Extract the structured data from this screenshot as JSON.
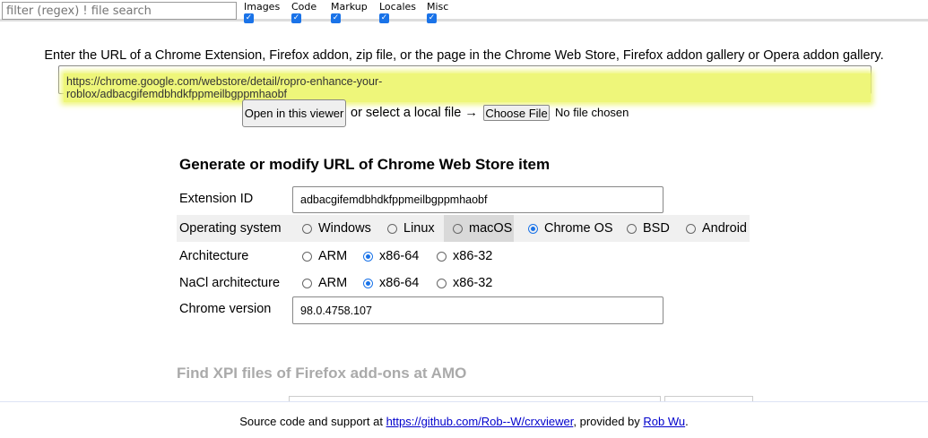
{
  "topbar": {
    "filter_placeholder": "filter (regex) ! file search",
    "checkboxes": [
      {
        "label": "Images",
        "checked": true
      },
      {
        "label": "Code",
        "checked": true
      },
      {
        "label": "Markup",
        "checked": true
      },
      {
        "label": "Locales",
        "checked": true
      },
      {
        "label": "Misc",
        "checked": true
      }
    ]
  },
  "main": {
    "instruction": "Enter the URL of a Chrome Extension, Firefox addon, zip file, or the page in the Chrome Web Store, Firefox addon gallery or Opera addon gallery.",
    "url_value": "https://chrome.google.com/webstore/detail/ropro-enhance-your-roblox/adbacgifemdbhdkfppmeilbgppmhaobf",
    "open_button": "Open in this viewer",
    "or_local": "or select a local file →",
    "choose_file": "Choose File",
    "no_file": "No file chosen"
  },
  "cws": {
    "heading": "Generate or modify URL of Chrome Web Store item",
    "ext_id_label": "Extension ID",
    "ext_id_value": "adbacgifemdbhdkfppmeilbgppmhaobf",
    "os_label": "Operating system",
    "os_options": [
      "Windows",
      "Linux",
      "macOS",
      "Chrome OS",
      "BSD",
      "Android"
    ],
    "os_selected": "Chrome OS",
    "arch_label": "Architecture",
    "arch_options": [
      "ARM",
      "x86-64",
      "x86-32"
    ],
    "arch_selected": "x86-64",
    "nacl_label": "NaCl architecture",
    "nacl_options": [
      "ARM",
      "x86-64",
      "x86-32"
    ],
    "nacl_selected": "x86-64",
    "version_label": "Chrome version",
    "version_value": "98.0.4758.107"
  },
  "amo": {
    "heading": "Find XPI files of Firefox add-ons at AMO"
  },
  "footer": {
    "prefix": "Source code and support at ",
    "repo_link": "https://github.com/Rob--W/crxviewer",
    "middle": ", provided by ",
    "author_link": "Rob Wu",
    "suffix": "."
  },
  "colors": {
    "highlight": "#eef67a",
    "accent": "#1a73e8"
  }
}
